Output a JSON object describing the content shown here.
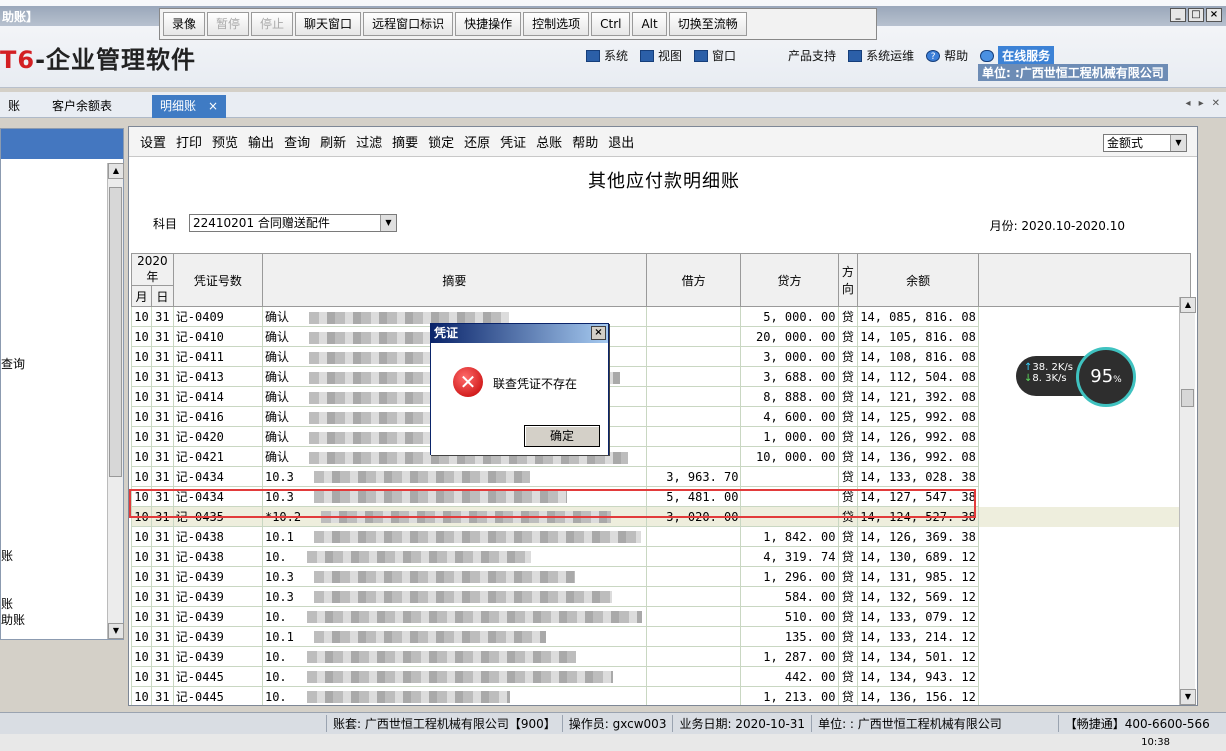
{
  "window": {
    "title": "助账】",
    "ctrl_min": "_",
    "ctrl_max": "□",
    "ctrl_close": "×"
  },
  "app": {
    "logo_prefix": "T6",
    "logo_text": "-企业管理软件"
  },
  "remote_toolbar": {
    "items": [
      {
        "label": "录像",
        "enabled": true
      },
      {
        "label": "暂停",
        "enabled": false
      },
      {
        "label": "停止",
        "enabled": false
      },
      {
        "label": "聊天窗口",
        "enabled": true
      },
      {
        "label": "远程窗口标识",
        "enabled": true
      },
      {
        "label": "快捷操作",
        "enabled": true
      },
      {
        "label": "控制选项",
        "enabled": true
      },
      {
        "label": "Ctrl",
        "enabled": true
      },
      {
        "label": "Alt",
        "enabled": true
      },
      {
        "label": "切换至流畅",
        "enabled": true
      }
    ]
  },
  "sysmenu": {
    "system": "系统",
    "view": "视图",
    "window": "窗口",
    "product_support": "产品支持",
    "ops": "系统运维",
    "help": "帮助",
    "online_service": "在线服务",
    "unit": "单位: :广西世恒工程机械有限公司"
  },
  "tabs": {
    "partial": "账",
    "customer_balance": "客户余额表",
    "detail": "明细账",
    "close": "×"
  },
  "left_panel": {
    "items": [
      {
        "label": "查询"
      },
      {
        "label": "账"
      },
      {
        "label": "账"
      },
      {
        "label": "助账"
      }
    ]
  },
  "toolbar": {
    "items": [
      "设置",
      "打印",
      "预览",
      "输出",
      "查询",
      "刷新",
      "过滤",
      "摘要",
      "锁定",
      "还原",
      "凭证",
      "总账",
      "帮助",
      "退出"
    ],
    "amount_format": "金额式"
  },
  "report": {
    "title": "其他应付款明细账",
    "subject_label": "科目",
    "subject_value": "22410201 合同赠送配件",
    "period": "月份: 2020.10-2020.10"
  },
  "table": {
    "year_header": "2020年",
    "month_header": "月",
    "day_header": "日",
    "voucher_header": "凭证号数",
    "summary_header": "摘要",
    "debit_header": "借方",
    "credit_header": "贷方",
    "direction_header": "方向",
    "balance_header": "余额",
    "rows": [
      {
        "m": "10",
        "d": "31",
        "v": "记-0409",
        "s": "确认",
        "debit": "",
        "credit": "5, 000. 00",
        "dir": "贷",
        "bal": "14, 085, 816. 08"
      },
      {
        "m": "10",
        "d": "31",
        "v": "记-0410",
        "s": "确认",
        "debit": "",
        "credit": "20, 000. 00",
        "dir": "贷",
        "bal": "14, 105, 816. 08"
      },
      {
        "m": "10",
        "d": "31",
        "v": "记-0411",
        "s": "确认",
        "debit": "",
        "credit": "3, 000. 00",
        "dir": "贷",
        "bal": "14, 108, 816. 08"
      },
      {
        "m": "10",
        "d": "31",
        "v": "记-0413",
        "s": "确认",
        "debit": "",
        "credit": "3, 688. 00",
        "dir": "贷",
        "bal": "14, 112, 504. 08"
      },
      {
        "m": "10",
        "d": "31",
        "v": "记-0414",
        "s": "确认",
        "debit": "",
        "credit": "8, 888. 00",
        "dir": "贷",
        "bal": "14, 121, 392. 08"
      },
      {
        "m": "10",
        "d": "31",
        "v": "记-0416",
        "s": "确认",
        "debit": "",
        "credit": "4, 600. 00",
        "dir": "贷",
        "bal": "14, 125, 992. 08"
      },
      {
        "m": "10",
        "d": "31",
        "v": "记-0420",
        "s": "确认",
        "debit": "",
        "credit": "1, 000. 00",
        "dir": "贷",
        "bal": "14, 126, 992. 08"
      },
      {
        "m": "10",
        "d": "31",
        "v": "记-0421",
        "s": "确认",
        "debit": "",
        "credit": "10, 000. 00",
        "dir": "贷",
        "bal": "14, 136, 992. 08"
      },
      {
        "m": "10",
        "d": "31",
        "v": "记-0434",
        "s": "10.3",
        "debit": "3, 963. 70",
        "credit": "",
        "dir": "贷",
        "bal": "14, 133, 028. 38"
      },
      {
        "m": "10",
        "d": "31",
        "v": "记-0434",
        "s": "10.3",
        "debit": "5, 481. 00",
        "credit": "",
        "dir": "贷",
        "bal": "14, 127, 547. 38"
      },
      {
        "m": "10",
        "d": "31",
        "v": "记-0435",
        "s": "*10.2",
        "debit": "3, 020. 00",
        "credit": "",
        "dir": "贷",
        "bal": "14, 124, 527. 38",
        "highlight": true
      },
      {
        "m": "10",
        "d": "31",
        "v": "记-0438",
        "s": "10.1",
        "debit": "",
        "credit": "1, 842. 00",
        "dir": "贷",
        "bal": "14, 126, 369. 38"
      },
      {
        "m": "10",
        "d": "31",
        "v": "记-0438",
        "s": "10.",
        "debit": "",
        "credit": "4, 319. 74",
        "dir": "贷",
        "bal": "14, 130, 689. 12"
      },
      {
        "m": "10",
        "d": "31",
        "v": "记-0439",
        "s": "10.3",
        "debit": "",
        "credit": "1, 296. 00",
        "dir": "贷",
        "bal": "14, 131, 985. 12"
      },
      {
        "m": "10",
        "d": "31",
        "v": "记-0439",
        "s": "10.3",
        "debit": "",
        "credit": "584. 00",
        "dir": "贷",
        "bal": "14, 132, 569. 12"
      },
      {
        "m": "10",
        "d": "31",
        "v": "记-0439",
        "s": "10.",
        "debit": "",
        "credit": "510. 00",
        "dir": "贷",
        "bal": "14, 133, 079. 12"
      },
      {
        "m": "10",
        "d": "31",
        "v": "记-0439",
        "s": "10.1",
        "debit": "",
        "credit": "135. 00",
        "dir": "贷",
        "bal": "14, 133, 214. 12"
      },
      {
        "m": "10",
        "d": "31",
        "v": "记-0439",
        "s": "10.",
        "debit": "",
        "credit": "1, 287. 00",
        "dir": "贷",
        "bal": "14, 134, 501. 12"
      },
      {
        "m": "10",
        "d": "31",
        "v": "记-0445",
        "s": "10.",
        "debit": "",
        "credit": "442. 00",
        "dir": "贷",
        "bal": "14, 134, 943. 12"
      },
      {
        "m": "10",
        "d": "31",
        "v": "记-0445",
        "s": "10.",
        "debit": "",
        "credit": "1, 213. 00",
        "dir": "贷",
        "bal": "14, 136, 156. 12"
      }
    ]
  },
  "dialog": {
    "title": "凭证",
    "message": "联查凭证不存在",
    "ok": "确定",
    "close": "×"
  },
  "net_widget": {
    "up": "38. 2K/s",
    "down": "8. 3K/s",
    "percent": "95",
    "percent_unit": "%"
  },
  "statusbar": {
    "account": "账套: 广西世恒工程机械有限公司【900】",
    "operator": "操作员: gxcw003",
    "biz_date": "业务日期: 2020-10-31",
    "unit": "单位: : 广西世恒工程机械有限公司",
    "hotline": "【畅捷通】400-6600-566"
  },
  "taskbar": {
    "clock": "10:38"
  }
}
